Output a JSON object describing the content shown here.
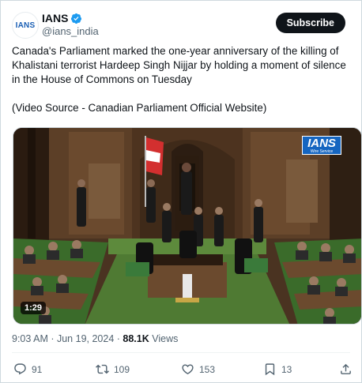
{
  "post": {
    "author": {
      "display_name": "IANS",
      "handle": "@ians_india",
      "avatar_text": "IANS",
      "verified": true
    },
    "subscribe_label": "Subscribe",
    "text": {
      "paragraph1": "Canada's Parliament marked the one-year anniversary of the killing of Khalistani terrorist Hardeep Singh Nijjar by holding a moment of silence in the House of Commons on Tuesday",
      "paragraph2": "(Video Source - Canadian Parliament Official Website)"
    },
    "video": {
      "duration": "1:29",
      "watermark": "IANS",
      "watermark_sub": "Wire Service"
    },
    "meta": {
      "time": "9:03 AM",
      "separator1": " · ",
      "date": "Jun 19, 2024",
      "separator2": " · ",
      "views_count": "88.1K",
      "views_label": " Views"
    },
    "actions": {
      "replies": "91",
      "reposts": "109",
      "likes": "153",
      "bookmarks": "13"
    }
  },
  "colors": {
    "accent": "#1d9bf0",
    "text": "#0f1419",
    "muted": "#536471",
    "subscribe_bg": "#0f1419"
  }
}
